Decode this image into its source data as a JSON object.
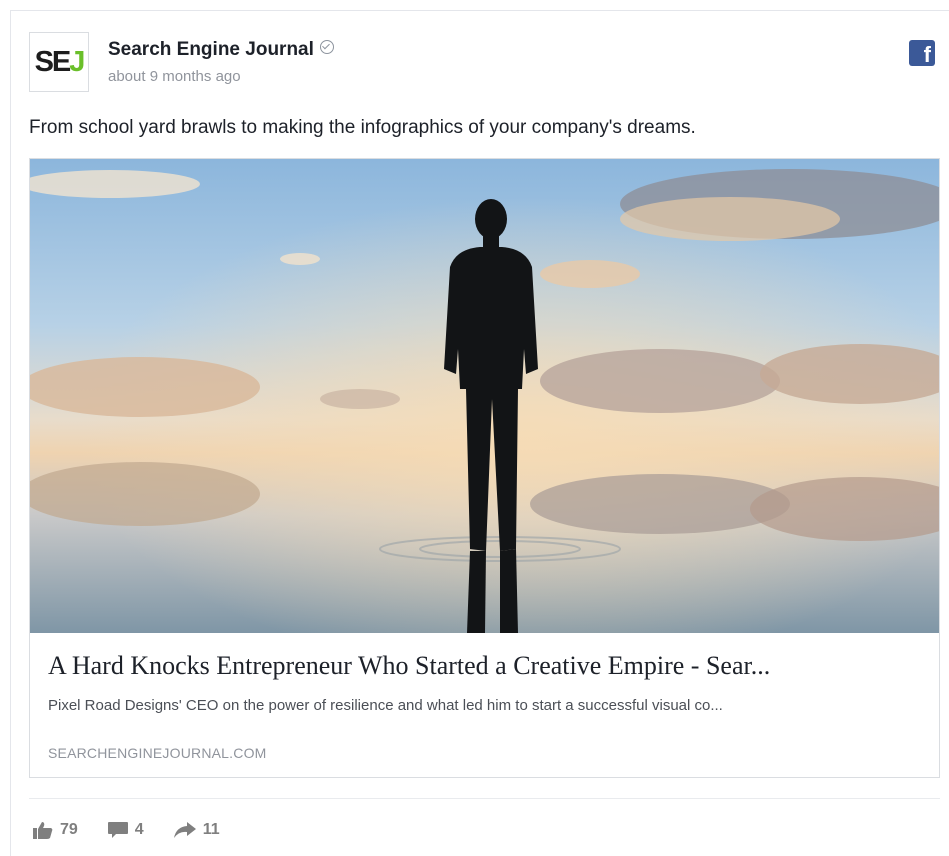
{
  "post": {
    "page_name": "Search Engine Journal",
    "timestamp": "about 9 months ago",
    "avatar": {
      "logo_main": "SE",
      "logo_accent": "J"
    },
    "message": "From school yard brawls to making the infographics of your company's dreams."
  },
  "card": {
    "title": "A Hard Knocks Entrepreneur Who Started a Creative Empire - Sear...",
    "description": "Pixel Road Designs' CEO on the power of resilience and what led him to start a successful visual co...",
    "domain": "SEARCHENGINEJOURNAL.COM"
  },
  "stats": {
    "likes": "79",
    "comments": "4",
    "shares": "11"
  },
  "icons": {
    "verified": "verified-check-icon",
    "facebook": "facebook-icon",
    "like": "thumbs-up-icon",
    "comment": "comment-icon",
    "share": "share-arrow-icon"
  },
  "colors": {
    "facebook_blue": "#3b5998",
    "logo_green": "#6abf2a",
    "muted": "#90949c"
  }
}
